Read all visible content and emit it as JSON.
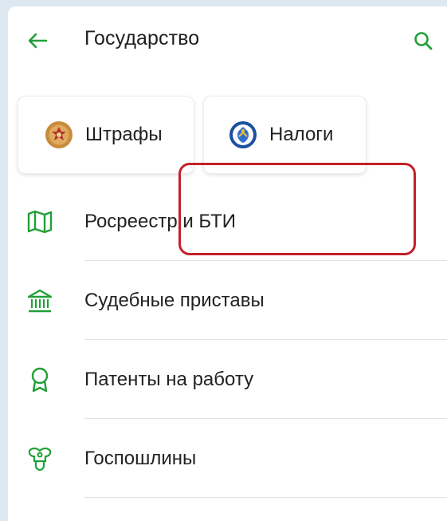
{
  "header": {
    "title": "Государство",
    "back_icon": "arrow-left-icon",
    "search_icon": "search-icon"
  },
  "chips": [
    {
      "label": "Штрафы",
      "icon": "gibdd-emblem-icon"
    },
    {
      "label": "Налоги",
      "icon": "fns-emblem-icon",
      "highlighted": true
    }
  ],
  "menu": [
    {
      "label": "Росреестр и БТИ",
      "icon": "map-icon"
    },
    {
      "label": "Судебные приставы",
      "icon": "courthouse-icon"
    },
    {
      "label": "Патенты на работу",
      "icon": "award-ribbon-icon"
    },
    {
      "label": "Госпошлины",
      "icon": "coat-of-arms-icon"
    }
  ],
  "colors": {
    "accent_green": "#21a038",
    "highlight_red": "#c4202a",
    "background": "#dde8f1"
  }
}
